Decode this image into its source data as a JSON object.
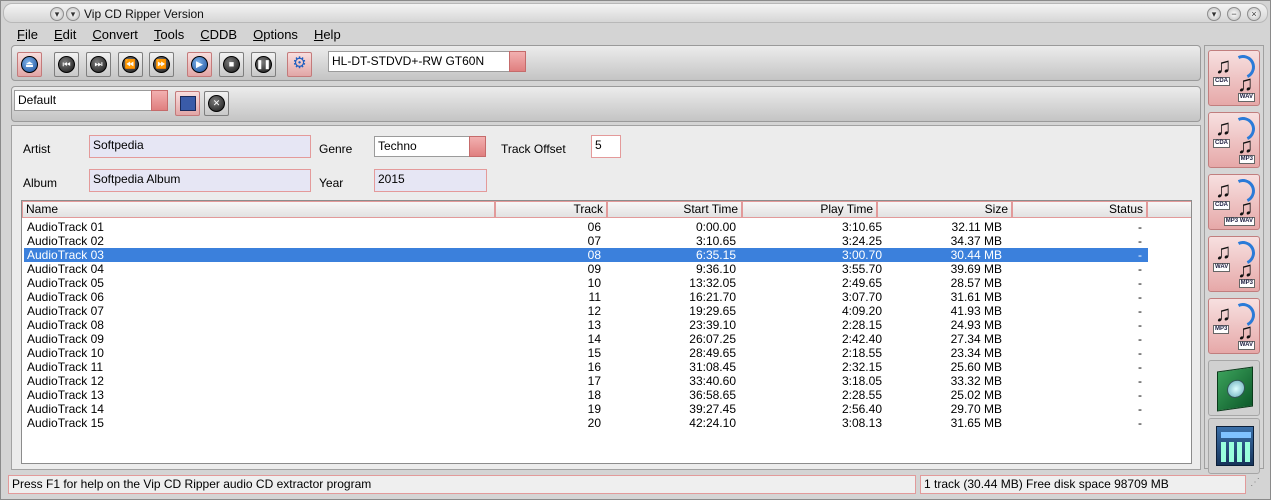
{
  "window": {
    "title": "Vip CD Ripper Version"
  },
  "menu": [
    {
      "label": "File",
      "underline": "F",
      "rest": "ile"
    },
    {
      "label": "Edit",
      "underline": "E",
      "rest": "dit"
    },
    {
      "label": "Convert",
      "underline": "C",
      "rest": "onvert"
    },
    {
      "label": "Tools",
      "underline": "T",
      "rest": "ools"
    },
    {
      "label": "CDDB",
      "underline": "C",
      "rest": "DDB"
    },
    {
      "label": "Options",
      "underline": "O",
      "rest": "ptions"
    },
    {
      "label": "Help",
      "underline": "H",
      "rest": "elp"
    }
  ],
  "toolbar": {
    "buttons": [
      {
        "name": "eject-button",
        "icon": "eject-icon",
        "glyph": "⏏"
      },
      {
        "name": "previous-track-button",
        "icon": "skip-back-icon",
        "glyph": "⏮"
      },
      {
        "name": "next-track-button",
        "icon": "skip-forward-icon",
        "glyph": "⏭"
      },
      {
        "name": "rewind-button",
        "icon": "rewind-icon",
        "glyph": "⏪"
      },
      {
        "name": "fast-forward-button",
        "icon": "fast-forward-icon",
        "glyph": "⏩"
      },
      {
        "name": "play-button",
        "icon": "play-icon",
        "glyph": "▶"
      },
      {
        "name": "stop-button",
        "icon": "stop-icon",
        "glyph": "■"
      },
      {
        "name": "pause-button",
        "icon": "pause-icon",
        "glyph": "❚❚"
      },
      {
        "name": "settings-button",
        "icon": "gear-icon",
        "glyph": "⚙"
      }
    ],
    "drive": "HL-DT-STDVD+-RW GT60N"
  },
  "profile": {
    "value": "Default"
  },
  "info": {
    "artist_label": "Artist",
    "artist": "Softpedia",
    "genre_label": "Genre",
    "genre": "Techno",
    "offset_label": "Track Offset",
    "offset": "5",
    "album_label": "Album",
    "album": "Softpedia Album",
    "year_label": "Year",
    "year": "2015"
  },
  "columns": {
    "name": "Name",
    "track": "Track",
    "start": "Start Time",
    "play": "Play Time",
    "size": "Size",
    "status": "Status"
  },
  "tracks": [
    {
      "name": "AudioTrack 01",
      "track": "06",
      "start": "0:00.00",
      "play": "3:10.65",
      "size": "32.11 MB",
      "status": "-"
    },
    {
      "name": "AudioTrack 02",
      "track": "07",
      "start": "3:10.65",
      "play": "3:24.25",
      "size": "34.37 MB",
      "status": "-"
    },
    {
      "name": "AudioTrack 03",
      "track": "08",
      "start": "6:35.15",
      "play": "3:00.70",
      "size": "30.44 MB",
      "status": "-",
      "selected": true
    },
    {
      "name": "AudioTrack 04",
      "track": "09",
      "start": "9:36.10",
      "play": "3:55.70",
      "size": "39.69 MB",
      "status": "-"
    },
    {
      "name": "AudioTrack 05",
      "track": "10",
      "start": "13:32.05",
      "play": "2:49.65",
      "size": "28.57 MB",
      "status": "-"
    },
    {
      "name": "AudioTrack 06",
      "track": "11",
      "start": "16:21.70",
      "play": "3:07.70",
      "size": "31.61 MB",
      "status": "-"
    },
    {
      "name": "AudioTrack 07",
      "track": "12",
      "start": "19:29.65",
      "play": "4:09.20",
      "size": "41.93 MB",
      "status": "-"
    },
    {
      "name": "AudioTrack 08",
      "track": "13",
      "start": "23:39.10",
      "play": "2:28.15",
      "size": "24.93 MB",
      "status": "-"
    },
    {
      "name": "AudioTrack 09",
      "track": "14",
      "start": "26:07.25",
      "play": "2:42.40",
      "size": "27.34 MB",
      "status": "-"
    },
    {
      "name": "AudioTrack 10",
      "track": "15",
      "start": "28:49.65",
      "play": "2:18.55",
      "size": "23.34 MB",
      "status": "-"
    },
    {
      "name": "AudioTrack 11",
      "track": "16",
      "start": "31:08.45",
      "play": "2:32.15",
      "size": "25.60 MB",
      "status": "-"
    },
    {
      "name": "AudioTrack 12",
      "track": "17",
      "start": "33:40.60",
      "play": "3:18.05",
      "size": "33.32 MB",
      "status": "-"
    },
    {
      "name": "AudioTrack 13",
      "track": "18",
      "start": "36:58.65",
      "play": "2:28.55",
      "size": "25.02 MB",
      "status": "-"
    },
    {
      "name": "AudioTrack 14",
      "track": "19",
      "start": "39:27.45",
      "play": "2:56.40",
      "size": "29.70 MB",
      "status": "-"
    },
    {
      "name": "AudioTrack 15",
      "track": "20",
      "start": "42:24.10",
      "play": "3:08.13",
      "size": "31.65 MB",
      "status": "-"
    }
  ],
  "sidebar": [
    {
      "name": "cda-to-wav-button",
      "from": "CDA",
      "to": "WAV"
    },
    {
      "name": "cda-to-mp3-button",
      "from": "CDA",
      "to": "MP3"
    },
    {
      "name": "cda-to-mp3-wav-button",
      "from": "CDA",
      "to": "MP3 WAV"
    },
    {
      "name": "wav-to-mp3-button",
      "from": "WAV",
      "to": "MP3"
    },
    {
      "name": "mp3-to-wav-button",
      "from": "MP3",
      "to": "WAV"
    }
  ],
  "status": {
    "help": "Press F1 for help on the Vip CD Ripper audio CD extractor program",
    "summary": "1 track (30.44 MB) Free disk space 98709 MB"
  },
  "colors": {
    "selection": "#3b80dc",
    "accent": "#e07f7f"
  }
}
